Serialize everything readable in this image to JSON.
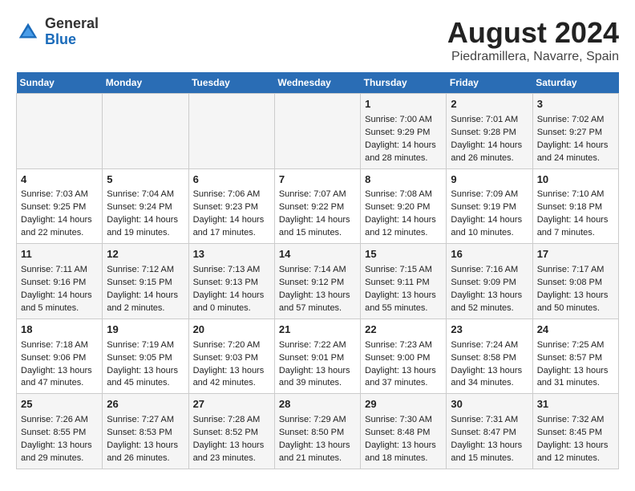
{
  "logo": {
    "general": "General",
    "blue": "Blue"
  },
  "title": "August 2024",
  "subtitle": "Piedramillera, Navarre, Spain",
  "days_of_week": [
    "Sunday",
    "Monday",
    "Tuesday",
    "Wednesday",
    "Thursday",
    "Friday",
    "Saturday"
  ],
  "weeks": [
    [
      {
        "day": "",
        "content": ""
      },
      {
        "day": "",
        "content": ""
      },
      {
        "day": "",
        "content": ""
      },
      {
        "day": "",
        "content": ""
      },
      {
        "day": "1",
        "content": "Sunrise: 7:00 AM\nSunset: 9:29 PM\nDaylight: 14 hours\nand 28 minutes."
      },
      {
        "day": "2",
        "content": "Sunrise: 7:01 AM\nSunset: 9:28 PM\nDaylight: 14 hours\nand 26 minutes."
      },
      {
        "day": "3",
        "content": "Sunrise: 7:02 AM\nSunset: 9:27 PM\nDaylight: 14 hours\nand 24 minutes."
      }
    ],
    [
      {
        "day": "4",
        "content": "Sunrise: 7:03 AM\nSunset: 9:25 PM\nDaylight: 14 hours\nand 22 minutes."
      },
      {
        "day": "5",
        "content": "Sunrise: 7:04 AM\nSunset: 9:24 PM\nDaylight: 14 hours\nand 19 minutes."
      },
      {
        "day": "6",
        "content": "Sunrise: 7:06 AM\nSunset: 9:23 PM\nDaylight: 14 hours\nand 17 minutes."
      },
      {
        "day": "7",
        "content": "Sunrise: 7:07 AM\nSunset: 9:22 PM\nDaylight: 14 hours\nand 15 minutes."
      },
      {
        "day": "8",
        "content": "Sunrise: 7:08 AM\nSunset: 9:20 PM\nDaylight: 14 hours\nand 12 minutes."
      },
      {
        "day": "9",
        "content": "Sunrise: 7:09 AM\nSunset: 9:19 PM\nDaylight: 14 hours\nand 10 minutes."
      },
      {
        "day": "10",
        "content": "Sunrise: 7:10 AM\nSunset: 9:18 PM\nDaylight: 14 hours\nand 7 minutes."
      }
    ],
    [
      {
        "day": "11",
        "content": "Sunrise: 7:11 AM\nSunset: 9:16 PM\nDaylight: 14 hours\nand 5 minutes."
      },
      {
        "day": "12",
        "content": "Sunrise: 7:12 AM\nSunset: 9:15 PM\nDaylight: 14 hours\nand 2 minutes."
      },
      {
        "day": "13",
        "content": "Sunrise: 7:13 AM\nSunset: 9:13 PM\nDaylight: 14 hours\nand 0 minutes."
      },
      {
        "day": "14",
        "content": "Sunrise: 7:14 AM\nSunset: 9:12 PM\nDaylight: 13 hours\nand 57 minutes."
      },
      {
        "day": "15",
        "content": "Sunrise: 7:15 AM\nSunset: 9:11 PM\nDaylight: 13 hours\nand 55 minutes."
      },
      {
        "day": "16",
        "content": "Sunrise: 7:16 AM\nSunset: 9:09 PM\nDaylight: 13 hours\nand 52 minutes."
      },
      {
        "day": "17",
        "content": "Sunrise: 7:17 AM\nSunset: 9:08 PM\nDaylight: 13 hours\nand 50 minutes."
      }
    ],
    [
      {
        "day": "18",
        "content": "Sunrise: 7:18 AM\nSunset: 9:06 PM\nDaylight: 13 hours\nand 47 minutes."
      },
      {
        "day": "19",
        "content": "Sunrise: 7:19 AM\nSunset: 9:05 PM\nDaylight: 13 hours\nand 45 minutes."
      },
      {
        "day": "20",
        "content": "Sunrise: 7:20 AM\nSunset: 9:03 PM\nDaylight: 13 hours\nand 42 minutes."
      },
      {
        "day": "21",
        "content": "Sunrise: 7:22 AM\nSunset: 9:01 PM\nDaylight: 13 hours\nand 39 minutes."
      },
      {
        "day": "22",
        "content": "Sunrise: 7:23 AM\nSunset: 9:00 PM\nDaylight: 13 hours\nand 37 minutes."
      },
      {
        "day": "23",
        "content": "Sunrise: 7:24 AM\nSunset: 8:58 PM\nDaylight: 13 hours\nand 34 minutes."
      },
      {
        "day": "24",
        "content": "Sunrise: 7:25 AM\nSunset: 8:57 PM\nDaylight: 13 hours\nand 31 minutes."
      }
    ],
    [
      {
        "day": "25",
        "content": "Sunrise: 7:26 AM\nSunset: 8:55 PM\nDaylight: 13 hours\nand 29 minutes."
      },
      {
        "day": "26",
        "content": "Sunrise: 7:27 AM\nSunset: 8:53 PM\nDaylight: 13 hours\nand 26 minutes."
      },
      {
        "day": "27",
        "content": "Sunrise: 7:28 AM\nSunset: 8:52 PM\nDaylight: 13 hours\nand 23 minutes."
      },
      {
        "day": "28",
        "content": "Sunrise: 7:29 AM\nSunset: 8:50 PM\nDaylight: 13 hours\nand 21 minutes."
      },
      {
        "day": "29",
        "content": "Sunrise: 7:30 AM\nSunset: 8:48 PM\nDaylight: 13 hours\nand 18 minutes."
      },
      {
        "day": "30",
        "content": "Sunrise: 7:31 AM\nSunset: 8:47 PM\nDaylight: 13 hours\nand 15 minutes."
      },
      {
        "day": "31",
        "content": "Sunrise: 7:32 AM\nSunset: 8:45 PM\nDaylight: 13 hours\nand 12 minutes."
      }
    ]
  ]
}
